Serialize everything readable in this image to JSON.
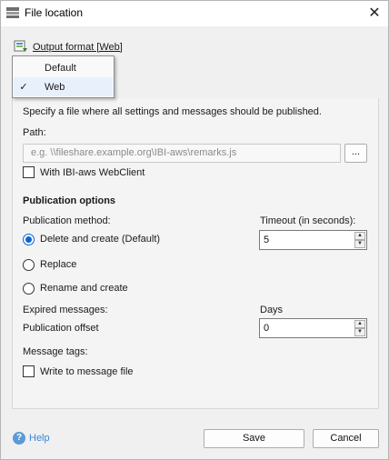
{
  "window": {
    "title": "File location",
    "close_glyph": "✕"
  },
  "output_format": {
    "label": "Output format [Web]"
  },
  "dropdown": {
    "items": [
      {
        "label": "Default",
        "checked": false
      },
      {
        "label": "Web",
        "checked": true,
        "check_glyph": "✓"
      }
    ]
  },
  "main": {
    "description": "Specify a file where all settings and messages should be published.",
    "path_label": "Path:",
    "path_placeholder": "e.g. \\\\fileshare.example.org\\IBI-aws\\remarks.js",
    "browse_label": "...",
    "webclient_label": "With IBI-aws WebClient",
    "publication_heading": "Publication options",
    "method_label": "Publication method:",
    "timeout_label": "Timeout (in seconds):",
    "timeout_value": "5",
    "methods": [
      {
        "label": "Delete and create (Default)",
        "checked": true
      },
      {
        "label": "Replace",
        "checked": false
      },
      {
        "label": "Rename and create",
        "checked": false
      }
    ],
    "expired_label": "Expired messages:",
    "days_label": "Days",
    "offset_label": "Publication offset",
    "offset_value": "0",
    "tags_label": "Message tags:",
    "write_label": "Write to message file"
  },
  "footer": {
    "help_label": "Help",
    "help_glyph": "?",
    "save_label": "Save",
    "cancel_label": "Cancel"
  },
  "colors": {
    "accent": "#0a64d6",
    "link": "#3b86d6"
  }
}
